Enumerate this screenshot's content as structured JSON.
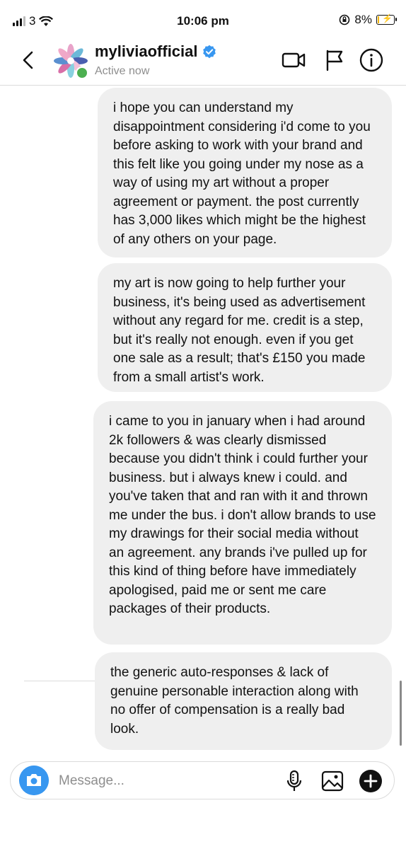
{
  "status_bar": {
    "carrier": "3",
    "time": "10:06 pm",
    "battery": "8%",
    "battery_level": 0.08
  },
  "header": {
    "username": "myliviaofficial",
    "status": "Active now",
    "icons": [
      "back-icon",
      "video-call-icon",
      "flag-icon",
      "info-icon"
    ]
  },
  "messages": [
    {
      "text": "i hope you can understand my disappointment considering i'd come to you before asking to work with your brand and this felt like you going under my nose as a way of using my art without a proper agreement or payment. the post currently has 3,000 likes which might be the highest of any others on your page."
    },
    {
      "text": "my art is now going to help further your business, it's being used as advertisement without any regard for me. credit is a step, but it's really not enough. even if you get one sale as a result; that's £150 you made from a small artist's work."
    },
    {
      "text": "i came to you in january when i had around 2k followers & was clearly dismissed because you didn't think i could further your business. but i always knew i could. and you've taken that and ran with it and thrown me under the bus. i don't allow brands to use my drawings for their social media without an agreement. any brands i've pulled up for this kind of thing before have immediately apologised, paid me or sent me care packages of their products."
    },
    {
      "text": "the generic auto-responses & lack of genuine personable interaction along with no offer of compensation is a really bad look."
    }
  ],
  "composer": {
    "placeholder": "Message...",
    "icons": [
      "camera-icon",
      "microphone-icon",
      "gallery-icon",
      "add-icon"
    ]
  },
  "colors": {
    "bubble": "#efefef",
    "accent": "#3897f0",
    "verified": "#3897f0",
    "online": "#4caf50",
    "battery": "#f2b600"
  }
}
